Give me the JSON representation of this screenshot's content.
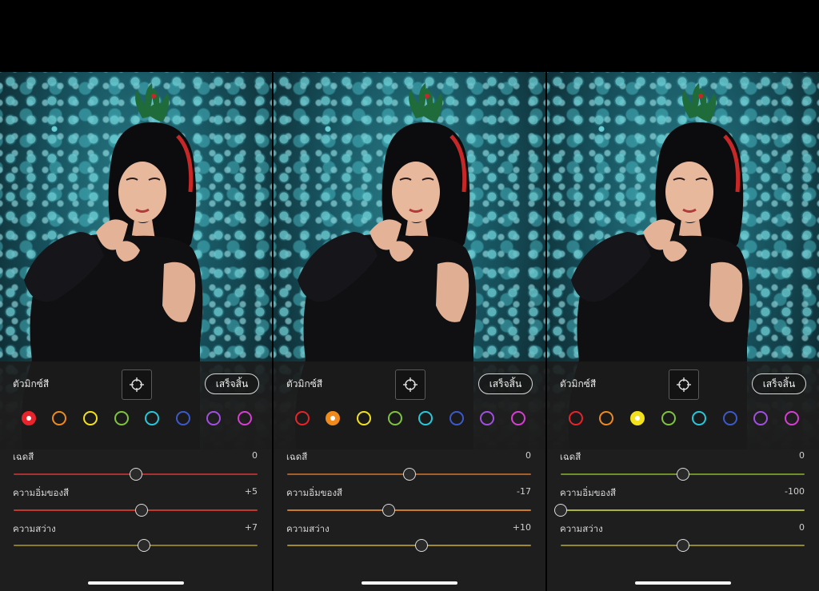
{
  "panels": [
    {
      "title": "ตัวมิกซ์สี",
      "done_label": "เสร็จสิ้น",
      "selected_swatch": 0,
      "sliders": [
        {
          "label": "เฉดสี",
          "value": "0",
          "fraction": 0.5
        },
        {
          "label": "ความอิ่มของสี",
          "value": "+5",
          "fraction": 0.525
        },
        {
          "label": "ความสว่าง",
          "value": "+7",
          "fraction": 0.535
        }
      ]
    },
    {
      "title": "ตัวมิกซ์สี",
      "done_label": "เสร็จสิ้น",
      "selected_swatch": 1,
      "sliders": [
        {
          "label": "เฉดสี",
          "value": "0",
          "fraction": 0.5
        },
        {
          "label": "ความอิ่มของสี",
          "value": "-17",
          "fraction": 0.415
        },
        {
          "label": "ความสว่าง",
          "value": "+10",
          "fraction": 0.55
        }
      ]
    },
    {
      "title": "ตัวมิกซ์สี",
      "done_label": "เสร็จสิ้น",
      "selected_swatch": 2,
      "sliders": [
        {
          "label": "เฉดสี",
          "value": "0",
          "fraction": 0.5
        },
        {
          "label": "ความอิ่มของสี",
          "value": "-100",
          "fraction": 0.0
        },
        {
          "label": "ความสว่าง",
          "value": "0",
          "fraction": 0.5
        }
      ]
    }
  ],
  "swatches": [
    {
      "name": "red",
      "color": "#e8232b"
    },
    {
      "name": "orange",
      "color": "#f08a1c"
    },
    {
      "name": "yellow",
      "color": "#f2e21b"
    },
    {
      "name": "green",
      "color": "#7fc43c"
    },
    {
      "name": "aqua",
      "color": "#26c9d9"
    },
    {
      "name": "blue",
      "color": "#3d59c9"
    },
    {
      "name": "purple",
      "color": "#a24ee0"
    },
    {
      "name": "magenta",
      "color": "#d63ed3"
    }
  ],
  "track_colors": [
    [
      "#a83232",
      "#c0392b",
      "#8a7a2a"
    ],
    [
      "#a4602a",
      "#c97a2a",
      "#9f8a30"
    ],
    [
      "#6f8f2a",
      "#a8b43a",
      "#8f8a30"
    ]
  ],
  "icons": {
    "target": "target-adjust-icon"
  }
}
